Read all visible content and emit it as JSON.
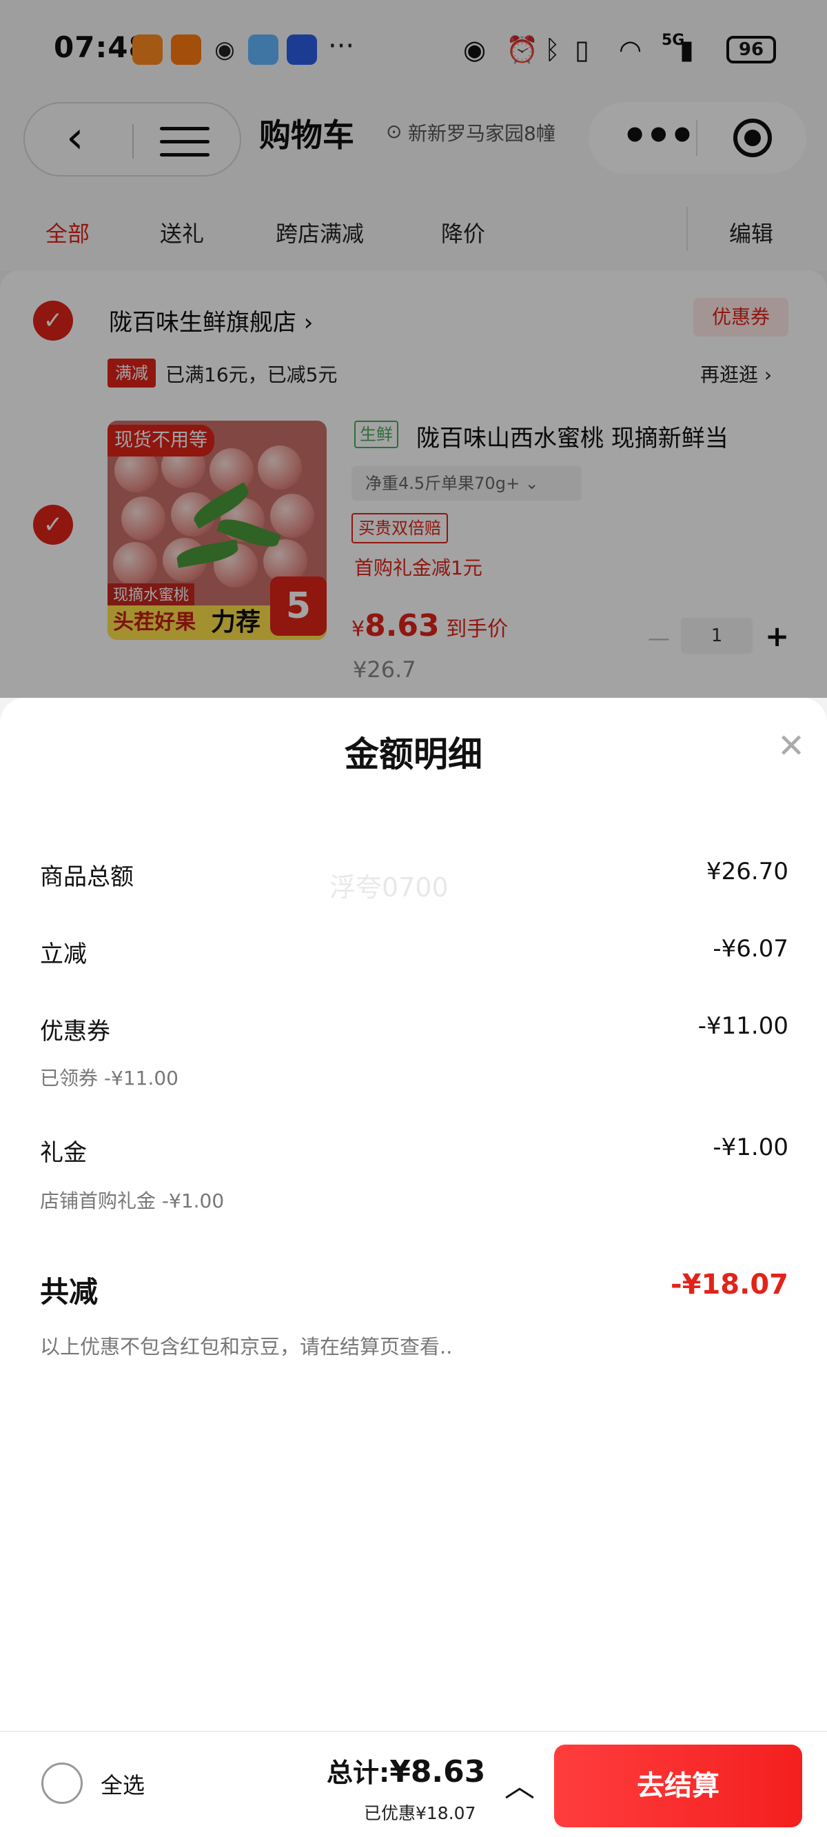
{
  "status_bar": {
    "time": "07:48",
    "more": "···",
    "battery": "96",
    "network": "5G"
  },
  "nav": {
    "back_icon": "chevron-left-icon",
    "title": "购物车",
    "location": "新新罗马家园8幢"
  },
  "tabs": [
    {
      "label": "全部",
      "active": true
    },
    {
      "label": "送礼",
      "active": false
    },
    {
      "label": "跨店满减",
      "active": false
    },
    {
      "label": "降价",
      "active": false
    }
  ],
  "edit_label": "编辑",
  "store": {
    "name": "陇百味生鲜旗舰店 ›",
    "coupon_label": "优惠券",
    "promo_tag": "满减",
    "promo_text": "已满16元，已减5元",
    "promo_link": "再逛逛 ›"
  },
  "product": {
    "image_tag": "现货不用等",
    "image_sub": "现摘水蜜桃",
    "image_banner": "头茬好果",
    "image_banner2": "力荐",
    "image_badge": "5",
    "fresh_tag": "生鲜",
    "title": "陇百味山西水蜜桃 现摘新鲜当",
    "spec": "净重4.5斤单果70g+  ⌄",
    "guarantee": "买贵双倍赔",
    "gift_text": "首购礼金减1元",
    "price_symbol": "¥",
    "price_value": "8.63",
    "price_suffix": "到手价",
    "original_price": "¥26.7",
    "quantity": "1"
  },
  "sheet": {
    "title": "金额明细",
    "close_icon": "close-icon",
    "watermark": "浮夸0700",
    "rows": [
      {
        "label": "商品总额",
        "value": "¥26.70",
        "sub": ""
      },
      {
        "label": "立减",
        "value": "-¥6.07",
        "sub": ""
      },
      {
        "label": "优惠券",
        "value": "-¥11.00",
        "sub": "已领券 -¥11.00"
      },
      {
        "label": "礼金",
        "value": "-¥1.00",
        "sub": "店铺首购礼金 -¥1.00"
      }
    ],
    "total_label": "共减",
    "total_value": "-¥18.07",
    "note": "以上优惠不包含红包和京豆，请在结算页查看.."
  },
  "bottom_bar": {
    "select_all": "全选",
    "sum_prefix": "总计:",
    "sum_value": "¥8.63",
    "saved": "已优惠¥18.07",
    "checkout": "去结算"
  },
  "colors": {
    "accent": "#e2231a",
    "overlay": "rgba(0,0,0,0.36)"
  }
}
